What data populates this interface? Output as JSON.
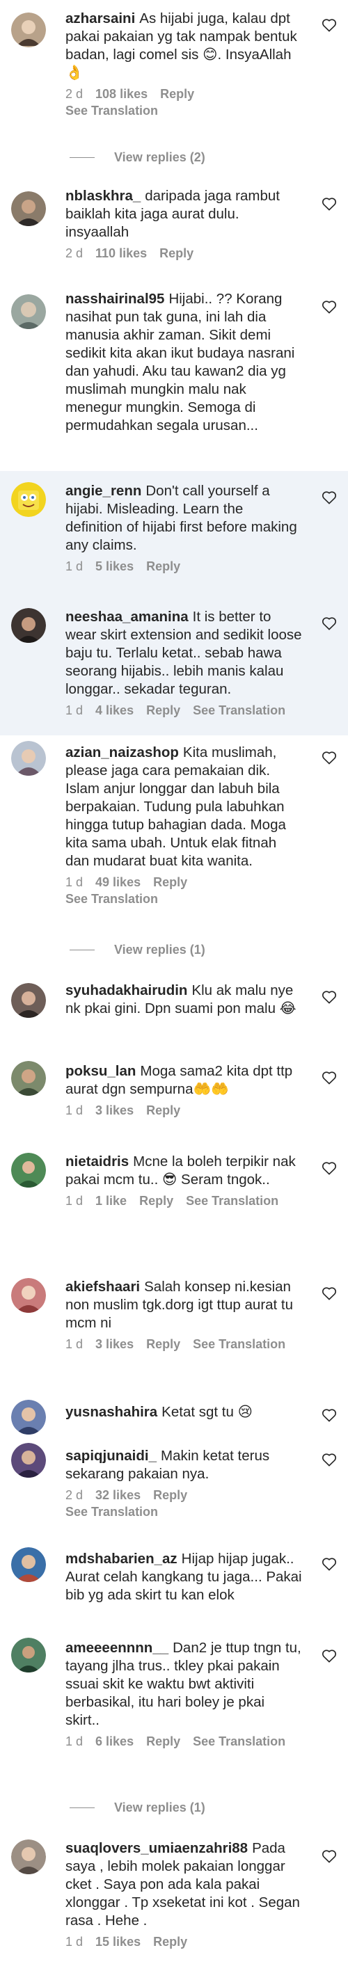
{
  "comments": [
    {
      "username": "azharsaini",
      "text": "As hijabi juga, kalau dpt pakai pakaian yg tak nampak bentuk badan, lagi comel sis 😊. InsyaAllah 👌",
      "time": "2 d",
      "likes": "108 likes",
      "reply": "Reply",
      "translation": "See Translation"
    },
    {
      "username": "nblaskhra_",
      "text": "daripada jaga rambut baiklah kita jaga aurat dulu. insyaallah",
      "time": "2 d",
      "likes": "110 likes",
      "reply": "Reply"
    },
    {
      "username": "nasshairinal95",
      "text": "Hijabi.. ?? Korang nasihat pun tak guna, ini lah dia manusia akhir zaman. Sikit demi sedikit kita akan ikut budaya nasrani dan yahudi. Aku tau kawan2 dia yg muslimah mungkin malu nak menegur mungkin. Semoga di permudahkan segala urusan..."
    },
    {
      "username": "angie_renn",
      "text": "Don't call yourself a hijabi. Misleading. Learn the definition of hijabi first before making any claims.",
      "time": "1 d",
      "likes": "5 likes",
      "reply": "Reply"
    },
    {
      "username": "neeshaa_amanina",
      "text": "It is better to wear skirt extension and sedikit loose baju tu. Terlalu ketat.. sebab hawa seorang hijabis.. lebih manis kalau longgar.. sekadar teguran.",
      "time": "1 d",
      "likes": "4 likes",
      "reply": "Reply",
      "translation": "See Translation"
    },
    {
      "username": "azian_naizashop",
      "text": "Kita muslimah, please jaga cara pemakaian dik. Islam anjur longgar dan labuh bila berpakaian. Tudung pula labuhkan hingga tutup bahagian dada. Moga kita sama ubah. Untuk elak fitnah dan mudarat buat kita wanita.",
      "time": "1 d",
      "likes": "49 likes",
      "reply": "Reply",
      "translation": "See Translation"
    },
    {
      "username": "syuhadakhairudin",
      "text": "Klu ak malu nye nk pkai gini. Dpn suami pon malu 😂"
    },
    {
      "username": "poksu_lan",
      "text": "Moga sama2 kita dpt ttp aurat dgn sempurna🤲🤲",
      "time": "1 d",
      "likes": "3 likes",
      "reply": "Reply"
    },
    {
      "username": "nietaidris",
      "text": "Mcne la boleh terpikir nak pakai mcm tu.. 😎 Seram tngok..",
      "time": "1 d",
      "likes": "1 like",
      "reply": "Reply",
      "translation": "See Translation"
    },
    {
      "username": "akiefshaari",
      "text": "Salah konsep ni.kesian non muslim tgk.dorg igt ttup aurat tu mcm ni",
      "time": "1 d",
      "likes": "3 likes",
      "reply": "Reply",
      "translation": "See Translation"
    },
    {
      "username": "yusnashahira",
      "text": "Ketat sgt tu 😢"
    },
    {
      "username": "sapiqjunaidi_",
      "text": "Makin ketat terus sekarang pakaian nya.",
      "time": "2 d",
      "likes": "32 likes",
      "reply": "Reply",
      "translation": "See Translation"
    },
    {
      "username": "mdshabarien_az",
      "text": "Hijap hijap jugak.. Aurat celah kangkang tu jaga... Pakai bib yg ada skirt tu kan elok"
    },
    {
      "username": "ameeeennnn__",
      "text": "Dan2 je ttup tngn tu, tayang jlha trus.. tkley pkai pakain ssuai skit ke waktu bwt aktiviti berbasikal, itu hari boley je pkai skirt..",
      "time": "1 d",
      "likes": "6 likes",
      "reply": "Reply",
      "translation": "See Translation"
    },
    {
      "username": "suaqlovers_umiaenzahri88",
      "text": "Pada saya , lebih molek pakaian longgar cket . Saya pon ada kala pakai xlonggar . Tp xseketat ini kot . Segan rasa . Hehe .",
      "time": "1 d",
      "likes": "15 likes",
      "reply": "Reply"
    }
  ],
  "view_replies": [
    "View replies (2)",
    "View replies (1)",
    "View replies (1)"
  ],
  "icons": {
    "like": "heart-outline-icon",
    "avatar": "user-avatar"
  },
  "colors": {
    "text": "#262626",
    "secondary": "#8e8e8e",
    "highlight": "#eff3f8"
  }
}
